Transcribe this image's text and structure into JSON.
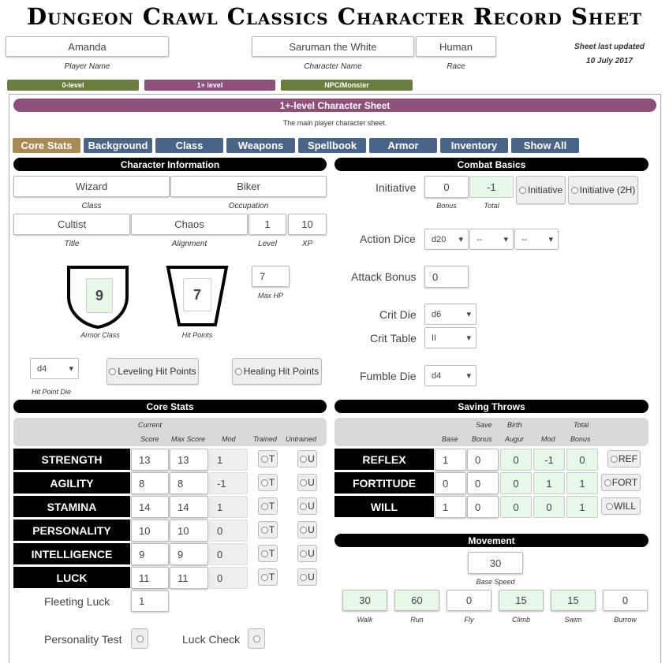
{
  "header": {
    "title": "Dungeon Crawl Classics Character Record Sheet",
    "updated_label": "Sheet last updated",
    "updated_date": "10 July 2017"
  },
  "player": {
    "name": "Amanda",
    "name_label": "Player Name",
    "character": "Saruman the White",
    "character_label": "Character Name",
    "race": "Human",
    "race_label": "Race"
  },
  "sheet_tabs": [
    {
      "label": "0-level",
      "color": "#6b7d3f"
    },
    {
      "label": "1+ level",
      "color": "#8e4f7b"
    },
    {
      "label": "NPC/Monster",
      "color": "#6b7d3f"
    }
  ],
  "sheet": {
    "title": "1+-level Character Sheet",
    "subtitle": "The main player character sheet."
  },
  "tabs": [
    "Core Stats",
    "Background",
    "Class",
    "Weapons",
    "Spellbook",
    "Armor",
    "Inventory",
    "Show All"
  ],
  "character_info": {
    "header": "Character Information",
    "class": "Wizard",
    "class_label": "Class",
    "occupation": "Biker",
    "occupation_label": "Occupation",
    "title": "Cultist",
    "title_label": "Title",
    "alignment": "Chaos",
    "alignment_label": "Alignment",
    "level": "1",
    "level_label": "Level",
    "xp": "10",
    "xp_label": "XP",
    "ac": "9",
    "ac_label": "Armor Class",
    "hp": "7",
    "hp_label": "Hit Points",
    "max_hp": "7",
    "max_hp_label": "Max HP",
    "hit_die": "d4",
    "hit_die_label": "Hit Point Die",
    "leveling_btn": "Leveling Hit Points",
    "healing_btn": "Healing Hit Points"
  },
  "combat": {
    "header": "Combat Basics",
    "initiative_label": "Initiative",
    "init_bonus": "0",
    "init_total": "-1",
    "bonus_label": "Bonus",
    "total_label": "Total",
    "init_btn": "Initiative",
    "init2h_btn": "Initiative (2H)",
    "action_dice_label": "Action Dice",
    "action_dice": [
      "d20",
      "--",
      "--"
    ],
    "attack_bonus_label": "Attack Bonus",
    "attack_bonus": "0",
    "crit_die_label": "Crit Die",
    "crit_die": "d6",
    "crit_table_label": "Crit Table",
    "crit_table": "II",
    "fumble_die_label": "Fumble Die",
    "fumble_die": "d4"
  },
  "core_stats": {
    "header": "Core Stats",
    "col_current": "Current",
    "col_score": "Score",
    "col_max": "Max Score",
    "col_mod": "Mod",
    "col_trained": "Trained",
    "col_untrained": "Untrained",
    "trained_btn": "T",
    "untrained_btn": "U",
    "rows": [
      {
        "name": "STRENGTH",
        "score": "13",
        "max": "13",
        "mod": "1"
      },
      {
        "name": "AGILITY",
        "score": "8",
        "max": "8",
        "mod": "-1"
      },
      {
        "name": "STAMINA",
        "score": "14",
        "max": "14",
        "mod": "1"
      },
      {
        "name": "PERSONALITY",
        "score": "10",
        "max": "10",
        "mod": "0"
      },
      {
        "name": "INTELLIGENCE",
        "score": "9",
        "max": "9",
        "mod": "0"
      },
      {
        "name": "LUCK",
        "score": "11",
        "max": "11",
        "mod": "0"
      }
    ],
    "fleeting_luck_label": "Fleeting Luck",
    "fleeting_luck": "1",
    "personality_test": "Personality Test",
    "luck_check": "Luck Check"
  },
  "saving_throws": {
    "header": "Saving Throws",
    "col_save": "Save",
    "col_bonus": "Bonus",
    "col_base": "Base",
    "col_bonus2": "Bonus",
    "col_birth": "Birth",
    "col_augur": "Augur",
    "col_mod": "Mod",
    "col_total": "Total",
    "col_tbonus": "Bonus",
    "rows": [
      {
        "name": "REFLEX",
        "base": "1",
        "bonus": "0",
        "augur": "0",
        "mod": "-1",
        "total": "0",
        "btn": "REF"
      },
      {
        "name": "FORTITUDE",
        "base": "0",
        "bonus": "0",
        "augur": "0",
        "mod": "1",
        "total": "1",
        "btn": "FORT"
      },
      {
        "name": "WILL",
        "base": "1",
        "bonus": "0",
        "augur": "0",
        "mod": "0",
        "total": "1",
        "btn": "WILL"
      }
    ]
  },
  "movement": {
    "header": "Movement",
    "base_speed": "30",
    "base_speed_label": "Base Speed",
    "modes": [
      {
        "label": "Walk",
        "value": "30"
      },
      {
        "label": "Run",
        "value": "60"
      },
      {
        "label": "Fly",
        "value": "0"
      },
      {
        "label": "Climb",
        "value": "15"
      },
      {
        "label": "Swim",
        "value": "15"
      },
      {
        "label": "Burrow",
        "value": "0"
      }
    ]
  },
  "colors": {
    "purple": "#8e4f7b",
    "olive": "#6b7d3f",
    "tab_blue": "#4a6487",
    "tab_active": "#a88a55",
    "green_field": "#e8f8e8"
  }
}
